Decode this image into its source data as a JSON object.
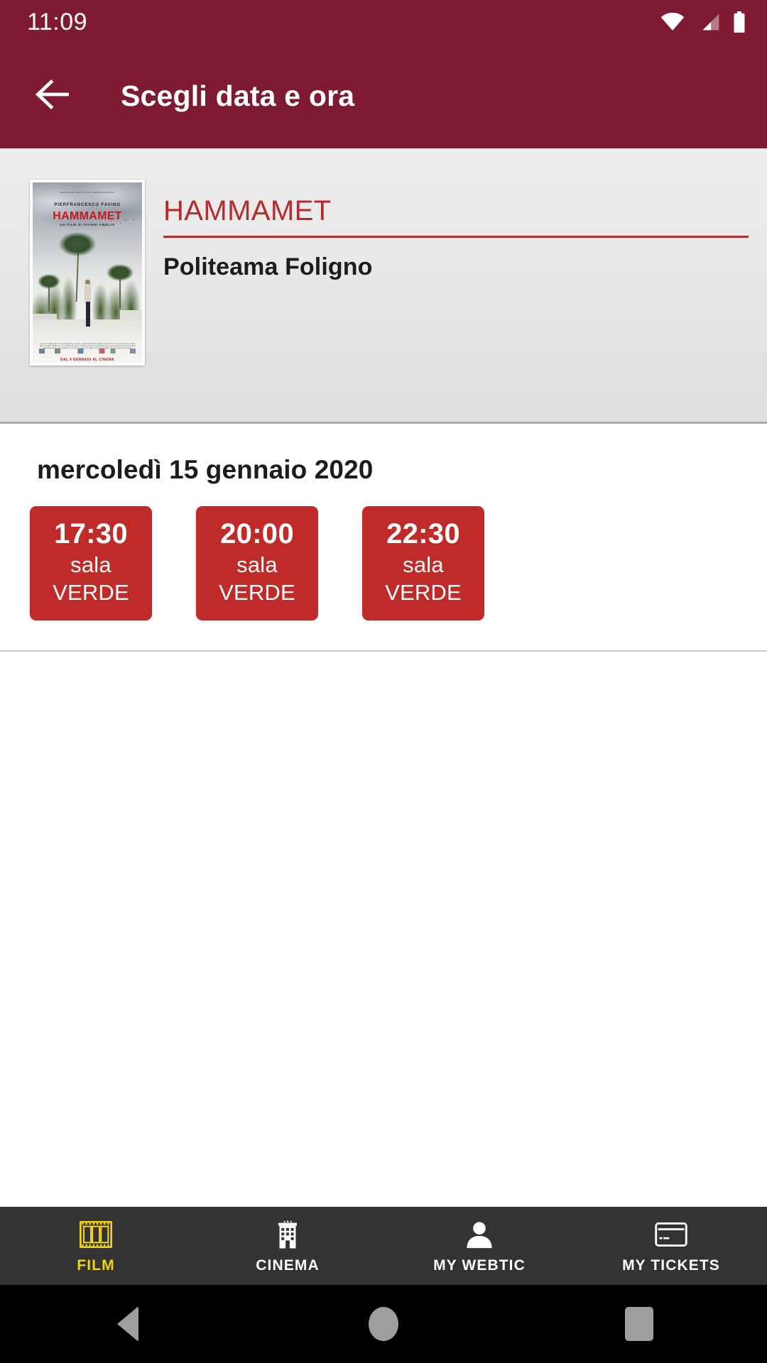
{
  "status_bar": {
    "time": "11:09",
    "icons": [
      "wifi-icon",
      "cellular-signal-icon",
      "battery-icon"
    ]
  },
  "app_bar": {
    "back_icon": "arrow-left-icon",
    "title": "Scegli data e ora"
  },
  "movie": {
    "title": "HAMMAMET",
    "cinema": "Politeama Foligno",
    "poster": {
      "credits_line": "PRODUZIONE PEPITO E RAI CINEMA PRESENTANO",
      "actor": "PIERFRANCESCO FAVINO",
      "title": "HAMMAMET",
      "director_line": "UN FILM DI\nGIANNI AMELIO",
      "small_print": "UN FILM DI GIANNI AMELIO CON PIERFRANCESCO FAVINO LIVIA ROSSI RENATO CARPENTIERI\nSOGGETTO E SCENEGGIATURA GIANNI AMELIO ALBERTO TARAGLIO FOTOGRAFIA LUAN AMELIO UJKAJ\nMONTAGGIO SIMONA PAGGI MUSICHE NICOLA PIOVANI SCENOGRAFIA MARTA MAFFUCCI\nCOSTUMI MAURIZIO MILLENOTTI PRODOTTO DA AGOSTINO SACCA MARCO POCCIONI MARCO VALSANIA",
      "tagline": "DAL 9 GENNAIO AL CINEMA"
    }
  },
  "showtimes": {
    "date_label": "mercoledì 15 gennaio 2020",
    "slots": [
      {
        "time": "17:30",
        "hall": "sala VERDE"
      },
      {
        "time": "20:00",
        "hall": "sala VERDE"
      },
      {
        "time": "22:30",
        "hall": "sala VERDE"
      }
    ]
  },
  "bottom_nav": {
    "items": [
      {
        "label": "FILM",
        "icon": "film-strip-icon",
        "active": true
      },
      {
        "label": "CINEMA",
        "icon": "cinema-building-icon",
        "active": false
      },
      {
        "label": "MY WEBTIC",
        "icon": "person-icon",
        "active": false
      },
      {
        "label": "MY TICKETS",
        "icon": "credit-card-icon",
        "active": false
      }
    ]
  },
  "android_nav": {
    "back": "triangle-back-icon",
    "home": "circle-home-icon",
    "recents": "square-recents-icon"
  },
  "colors": {
    "header": "#7E1B32",
    "accent_red": "#BE2B28",
    "title_red": "#B62B2B",
    "nav_bar": "#333333",
    "active_yellow": "#F2D31B",
    "card_bg": "#E8E8E8"
  }
}
